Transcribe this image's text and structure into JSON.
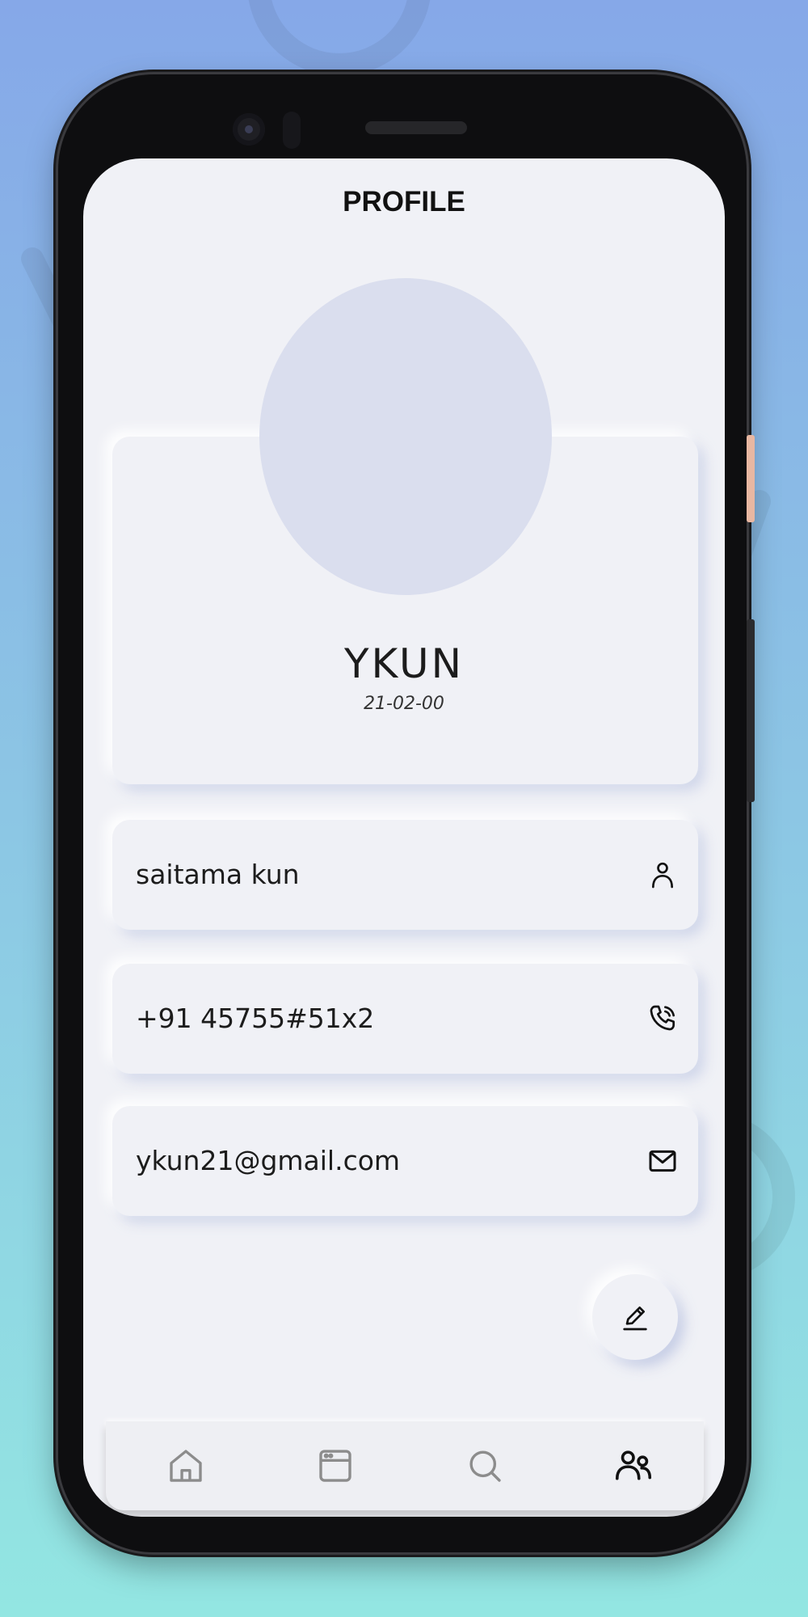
{
  "header": {
    "title": "PROFILE"
  },
  "profile": {
    "name": "YKUN",
    "dob": "21-02-00"
  },
  "info": {
    "username": "saitama kun",
    "phone": "+91 45755#51x2",
    "email": "ykun21@gmail.com"
  },
  "icons": {
    "username": "person-icon",
    "phone": "phone-icon",
    "email": "mail-icon",
    "edit": "pencil-icon"
  },
  "nav": {
    "items": [
      {
        "name": "home",
        "icon": "home-icon",
        "active": false
      },
      {
        "name": "browser",
        "icon": "browser-window-icon",
        "active": false
      },
      {
        "name": "search",
        "icon": "search-icon",
        "active": false
      },
      {
        "name": "users",
        "icon": "users-icon",
        "active": true
      }
    ]
  },
  "colors": {
    "screen_bg": "#f0f1f6",
    "avatar": "#dadeee",
    "active_icon": "#111111",
    "inactive_icon": "#8c8c8c"
  }
}
